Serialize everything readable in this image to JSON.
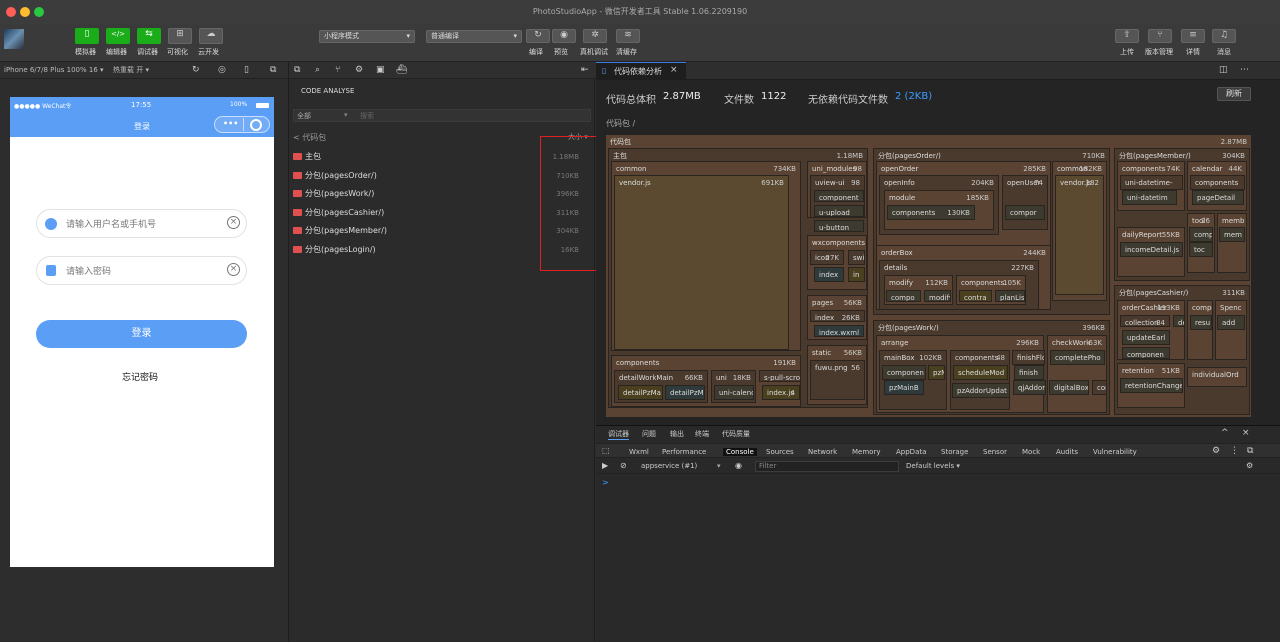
{
  "window": {
    "title": "PhotoStudioApp - 微信开发者工具 Stable 1.06.2209190"
  },
  "toolbar": {
    "left_buttons": [
      "模拟器",
      "编辑器",
      "调试器",
      "可视化",
      "云开发"
    ],
    "mode_select": "小程序模式",
    "compile_select": "普通编译",
    "mid_buttons": [
      "编译",
      "预览",
      "真机调试",
      "清缓存"
    ],
    "right_buttons": [
      "上传",
      "版本管理",
      "详情",
      "消息"
    ]
  },
  "simulator": {
    "device": "iPhone 6/7/8 Plus 100% 16 ▾",
    "hot_reload": "热重载 开 ▾",
    "status_carrier": "●●●●● WeChat令",
    "status_time": "17:55",
    "status_battery": "100%",
    "page_title": "登录",
    "username_placeholder": "请输入用户名或手机号",
    "password_placeholder": "请输入密码",
    "login_label": "登录",
    "forgot_label": "忘记密码"
  },
  "analyse": {
    "header": "CODE ANALYSE",
    "filter_all": "全部",
    "search_placeholder": "搜索",
    "breadcrumb": "< 代码包",
    "sort": "大小 ▾",
    "packages": [
      {
        "name": "主包",
        "size": "1.18MB"
      },
      {
        "name": "分包(pagesOrder/)",
        "size": "710KB"
      },
      {
        "name": "分包(pagesWork/)",
        "size": "396KB"
      },
      {
        "name": "分包(pagesCashier/)",
        "size": "311KB"
      },
      {
        "name": "分包(pagesMember/)",
        "size": "304KB"
      },
      {
        "name": "分包(pagesLogin/)",
        "size": "16KB"
      }
    ]
  },
  "dep": {
    "tab_title": "代码依赖分析",
    "total_label": "代码总体积",
    "total_value": "2.87MB",
    "files_label": "文件数",
    "files_value": "1122",
    "nodep_label": "无依赖代码文件数",
    "nodep_value": "2 (2KB)",
    "refresh": "刷新",
    "breadcrumb": "代码包 /",
    "root_label": "代码包",
    "root_size": "2.87MB"
  },
  "treemap": [
    {
      "l": "主包",
      "s": "1.18MB"
    },
    {
      "l": "common",
      "s": "734KB"
    },
    {
      "l": "vendor.js",
      "s": "691KB"
    },
    {
      "l": "uni_modules",
      "s": "98"
    },
    {
      "l": "uview-ui",
      "s": "98"
    },
    {
      "l": "component",
      "s": ""
    },
    {
      "l": "u-upload",
      "s": ""
    },
    {
      "l": "u-button",
      "s": ""
    },
    {
      "l": "wxcomponents",
      "s": ""
    },
    {
      "l": "icon",
      "s": "27K"
    },
    {
      "l": "swi",
      "s": ""
    },
    {
      "l": "index",
      "s": ""
    },
    {
      "l": "in",
      "s": ""
    },
    {
      "l": "pages",
      "s": "56KB"
    },
    {
      "l": "index",
      "s": "26KB"
    },
    {
      "l": "index.wxml",
      "s": ""
    },
    {
      "l": "static",
      "s": "56KB"
    },
    {
      "l": "fuwu.png",
      "s": "56"
    },
    {
      "l": "components",
      "s": "191KB"
    },
    {
      "l": "detailWorkMain",
      "s": "66KB"
    },
    {
      "l": "uni",
      "s": "18KB"
    },
    {
      "l": "s-pull-scro",
      "s": ""
    },
    {
      "l": "detailPzMa",
      "s": ""
    },
    {
      "l": "detailPzMa",
      "s": ""
    },
    {
      "l": "uni-calenc",
      "s": ""
    },
    {
      "l": "index.js",
      "s": "4"
    },
    {
      "l": "分包(pagesOrder/)",
      "s": "710KB"
    },
    {
      "l": "openOrder",
      "s": "285KB"
    },
    {
      "l": "openInfo",
      "s": "204KB"
    },
    {
      "l": "module",
      "s": "185KB"
    },
    {
      "l": "components",
      "s": "130KB"
    },
    {
      "l": "openUser",
      "s": "74"
    },
    {
      "l": "compor",
      "s": ""
    },
    {
      "l": "common",
      "s": "182KB"
    },
    {
      "l": "vendor.js",
      "s": "182"
    },
    {
      "l": "orderBox",
      "s": "244KB"
    },
    {
      "l": "details",
      "s": "227KB"
    },
    {
      "l": "modify",
      "s": "112KB"
    },
    {
      "l": "components",
      "s": "105K"
    },
    {
      "l": "compo",
      "s": ""
    },
    {
      "l": "modify",
      "s": ""
    },
    {
      "l": "contra",
      "s": ""
    },
    {
      "l": "planLis",
      "s": ""
    },
    {
      "l": "分包(pagesWork/)",
      "s": "396KB"
    },
    {
      "l": "arrange",
      "s": "296KB"
    },
    {
      "l": "checkWork",
      "s": "63K"
    },
    {
      "l": "mainBox",
      "s": "102KB"
    },
    {
      "l": "components",
      "s": "48"
    },
    {
      "l": "finishFlo",
      "s": ""
    },
    {
      "l": "completePho",
      "s": ""
    },
    {
      "l": "componen",
      "s": ""
    },
    {
      "l": "pzM",
      "s": ""
    },
    {
      "l": "scheduleMod",
      "s": ""
    },
    {
      "l": "finish",
      "s": ""
    },
    {
      "l": "pzMainB",
      "s": ""
    },
    {
      "l": "qjAddor",
      "s": ""
    },
    {
      "l": "pzAddorUpdat",
      "s": ""
    },
    {
      "l": "digitalBox",
      "s": ""
    },
    {
      "l": "con",
      "s": ""
    },
    {
      "l": "分包(pagesMember/)",
      "s": "304KB"
    },
    {
      "l": "components",
      "s": "74K"
    },
    {
      "l": "calendar",
      "s": "44K"
    },
    {
      "l": "uni-datetime-",
      "s": ""
    },
    {
      "l": "uni-datetim",
      "s": ""
    },
    {
      "l": "components",
      "s": ""
    },
    {
      "l": "pageDetail",
      "s": ""
    },
    {
      "l": "tool",
      "s": "26"
    },
    {
      "l": "memb",
      "s": ""
    },
    {
      "l": "dailyReport",
      "s": "55KB"
    },
    {
      "l": "comp",
      "s": ""
    },
    {
      "l": "mem",
      "s": ""
    },
    {
      "l": "incomeDetail.js",
      "s": ""
    },
    {
      "l": "toc",
      "s": ""
    },
    {
      "l": "分包(pagesCashier/)",
      "s": "311KB"
    },
    {
      "l": "orderCashier",
      "s": "113KB"
    },
    {
      "l": "compo",
      "s": ""
    },
    {
      "l": "Spenc",
      "s": ""
    },
    {
      "l": "collection",
      "s": "84"
    },
    {
      "l": "de",
      "s": ""
    },
    {
      "l": "resu",
      "s": ""
    },
    {
      "l": "add",
      "s": ""
    },
    {
      "l": "updateEarl",
      "s": ""
    },
    {
      "l": "componen",
      "s": ""
    },
    {
      "l": "retention",
      "s": "51KB"
    },
    {
      "l": "individualOrd",
      "s": ""
    },
    {
      "l": "retentionChange",
      "s": ""
    }
  ],
  "devtools": {
    "top_tabs": [
      "调试器",
      "问题",
      "输出",
      "终端",
      "代码质量"
    ],
    "panels": [
      "Wxml",
      "Performance",
      "Console",
      "Sources",
      "Network",
      "Memory",
      "AppData",
      "Storage",
      "Sensor",
      "Mock",
      "Audits",
      "Vulnerability"
    ],
    "context": "appservice (#1)",
    "filter_placeholder": "Filter",
    "levels": "Default levels ▾",
    "prompt": ">"
  },
  "colors": {
    "accent": "#1aad19",
    "blue": "#5b9ef5",
    "highlight": "#e02020"
  }
}
